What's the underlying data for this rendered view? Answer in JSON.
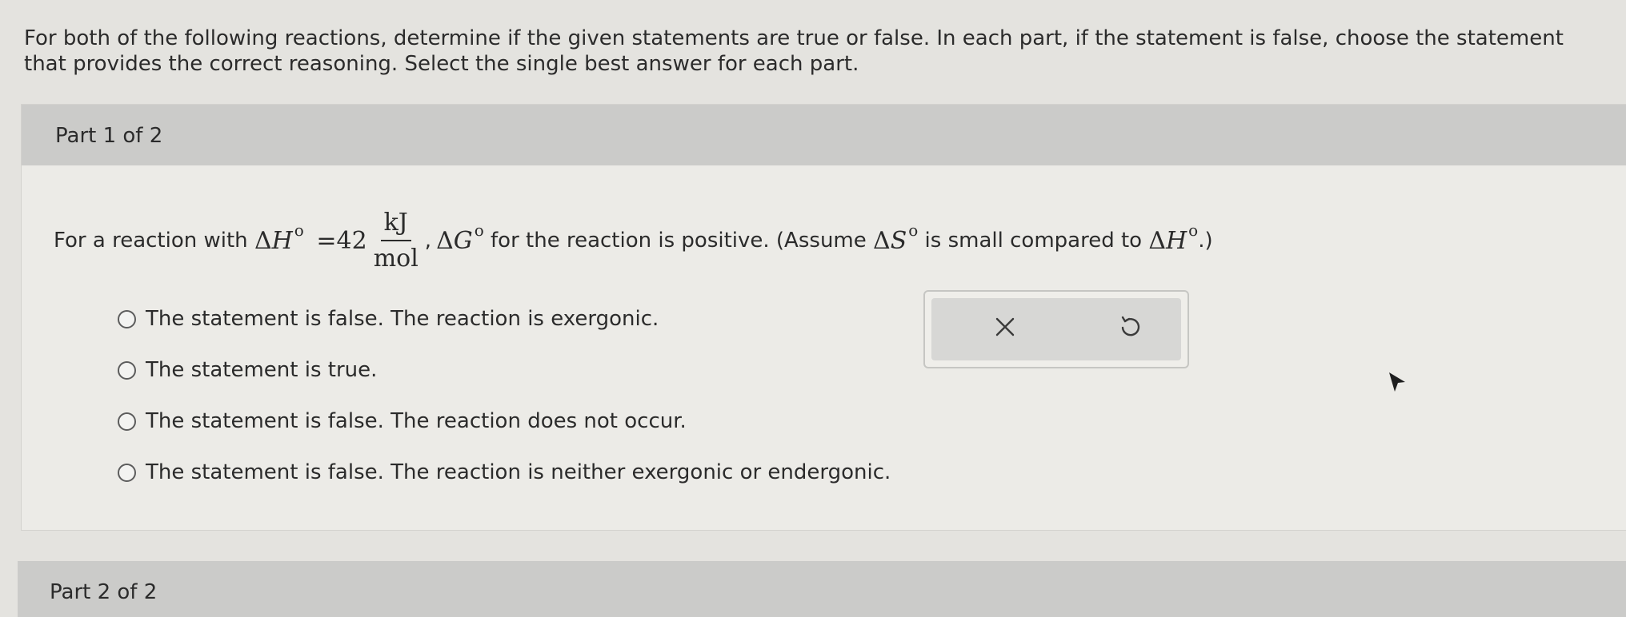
{
  "instructions": "For both of the following reactions, determine if the given statements are true or false. In each part, if the statement is false, choose the statement that provides the correct reasoning. Select the single best answer for each part.",
  "part1": {
    "header": "Part 1 of 2",
    "question": {
      "prefix": "For a reaction with ",
      "delta": "Δ",
      "H": "H",
      "G": "G",
      "S": "S",
      "degree": "o",
      "equals_value": "=42",
      "unit_num": "kJ",
      "unit_den": "mol",
      "comma": ",",
      "middle": " for the reaction is positive. (Assume ",
      "middle2": " is small compared to ",
      "end": ".)"
    },
    "options": [
      "The statement is false. The reaction is exergonic.",
      "The statement is true.",
      "The statement is false. The reaction does not occur.",
      "The statement is false. The reaction is neither exergonic or endergonic."
    ],
    "actions": {
      "clear_icon": "x-icon",
      "undo_icon": "undo-icon"
    }
  },
  "part2": {
    "header": "Part 2 of 2"
  }
}
